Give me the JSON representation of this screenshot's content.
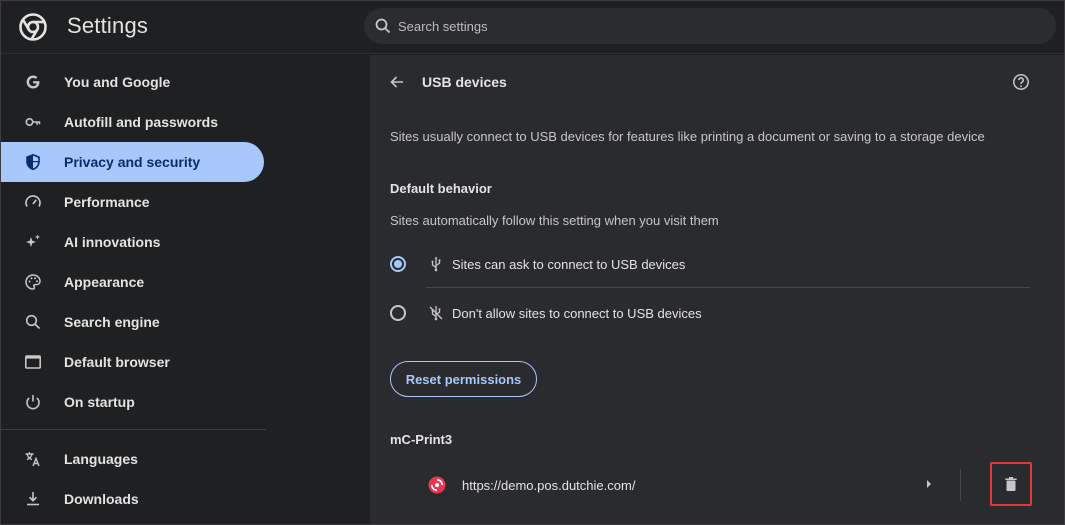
{
  "header": {
    "title": "Settings",
    "search_placeholder": "Search settings",
    "logo_icon": "chrome-logo-icon",
    "search_icon": "search-icon"
  },
  "sidebar": {
    "items": [
      {
        "label": "You and Google",
        "icon": "google-g-icon",
        "active": false
      },
      {
        "label": "Autofill and passwords",
        "icon": "key-icon",
        "active": false
      },
      {
        "label": "Privacy and security",
        "icon": "shield-icon",
        "active": true
      },
      {
        "label": "Performance",
        "icon": "gauge-icon",
        "active": false
      },
      {
        "label": "AI innovations",
        "icon": "sparkle-icon",
        "active": false
      },
      {
        "label": "Appearance",
        "icon": "palette-icon",
        "active": false
      },
      {
        "label": "Search engine",
        "icon": "search-icon",
        "active": false
      },
      {
        "label": "Default browser",
        "icon": "browser-window-icon",
        "active": false
      },
      {
        "label": "On startup",
        "icon": "power-icon",
        "active": false
      },
      {
        "label": "Languages",
        "icon": "translate-icon",
        "active": false
      },
      {
        "label": "Downloads",
        "icon": "download-icon",
        "active": false
      }
    ]
  },
  "main": {
    "title": "USB devices",
    "description": "Sites usually connect to USB devices for features like printing a document or saving to a storage device",
    "default_behavior": {
      "heading": "Default behavior",
      "subtitle": "Sites automatically follow this setting when you visit them",
      "options": [
        {
          "label": "Sites can ask to connect to USB devices",
          "icon": "usb-icon",
          "checked": true
        },
        {
          "label": "Don't allow sites to connect to USB devices",
          "icon": "usb-off-icon",
          "checked": false
        }
      ]
    },
    "reset_label": "Reset permissions",
    "device": {
      "name": "mC-Print3",
      "site_url": "https://demo.pos.dutchie.com/",
      "favicon": "dutchie-favicon-icon"
    }
  },
  "colors": {
    "accent": "#a8c7fa",
    "active_text": "#062e6f",
    "highlight_border": "#e0383e",
    "panel_bg": "#2a2b2e",
    "page_bg": "#1f2022"
  }
}
